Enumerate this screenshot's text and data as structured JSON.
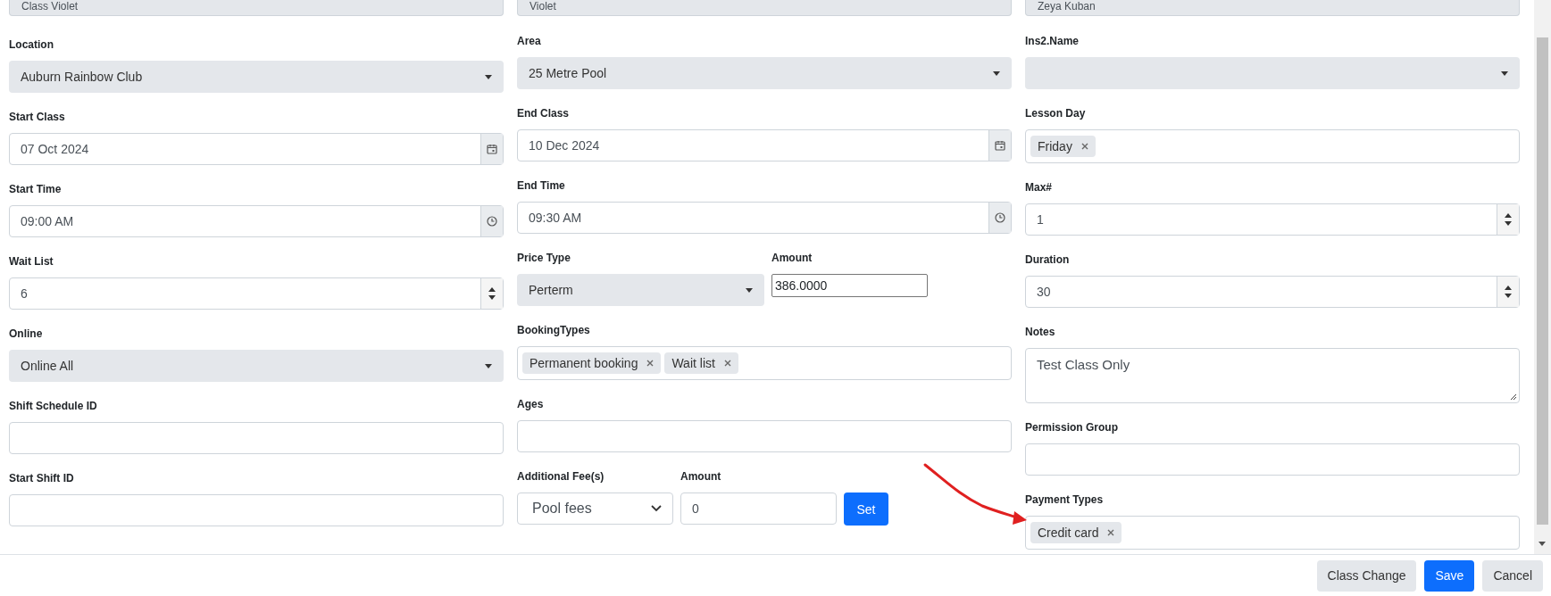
{
  "top_fields": [
    {
      "value": "Class Violet"
    },
    {
      "value": "Violet"
    },
    {
      "value": "Zeya Kuban"
    }
  ],
  "columns": [
    [
      {
        "kind": "select",
        "label": "Location",
        "value": "Auburn Rainbow Club"
      },
      {
        "kind": "date",
        "label": "Start Class",
        "value": "07 Oct 2024"
      },
      {
        "kind": "time",
        "label": "Start Time",
        "value": "09:00 AM"
      },
      {
        "kind": "number",
        "label": "Wait List",
        "value": "6"
      },
      {
        "kind": "select",
        "label": "Online",
        "value": "Online All"
      },
      {
        "kind": "text",
        "label": "Shift Schedule ID"
      },
      {
        "kind": "text",
        "label": "Start Shift ID"
      }
    ],
    [
      {
        "kind": "select",
        "label": "Area",
        "value": "25 Metre Pool"
      },
      {
        "kind": "date",
        "label": "End Class",
        "value": "10 Dec 2024"
      },
      {
        "kind": "time",
        "label": "End Time",
        "value": "09:30 AM"
      },
      {
        "kind": "row",
        "items": [
          {
            "kind": "select",
            "label": "Price Type",
            "value": "Perterm"
          },
          {
            "kind": "input",
            "label": "Amount",
            "value": "386.0000"
          }
        ]
      },
      {
        "kind": "tags",
        "label": "BookingTypes",
        "tags": [
          "Permanent booking",
          "Wait list"
        ]
      },
      {
        "kind": "text",
        "label": "Ages"
      },
      {
        "kind": "row",
        "items": [
          {
            "kind": "native-select",
            "label": "Additional Fee(s)",
            "value": "Pool fees"
          },
          {
            "kind": "text",
            "label": "Amount",
            "value": "0"
          },
          {
            "kind": "button",
            "label": "Set"
          }
        ]
      }
    ],
    [
      {
        "kind": "select",
        "label": "Ins2.Name"
      },
      {
        "kind": "tags",
        "label": "Lesson Day",
        "tags": [
          "Friday"
        ]
      },
      {
        "kind": "number",
        "label": "Max#",
        "value": "1"
      },
      {
        "kind": "number",
        "label": "Duration",
        "value": "30"
      },
      {
        "kind": "textarea",
        "label": "Notes",
        "value": "Test Class Only"
      },
      {
        "kind": "text",
        "label": "Permission Group"
      },
      {
        "kind": "tags",
        "label": "Payment Types",
        "tags": [
          "Credit card"
        ]
      }
    ]
  ],
  "footer_buttons": [
    {
      "label": "Class Change",
      "kind": "secondary"
    },
    {
      "label": "Save",
      "kind": "primary"
    },
    {
      "label": "Cancel",
      "kind": "secondary"
    }
  ]
}
